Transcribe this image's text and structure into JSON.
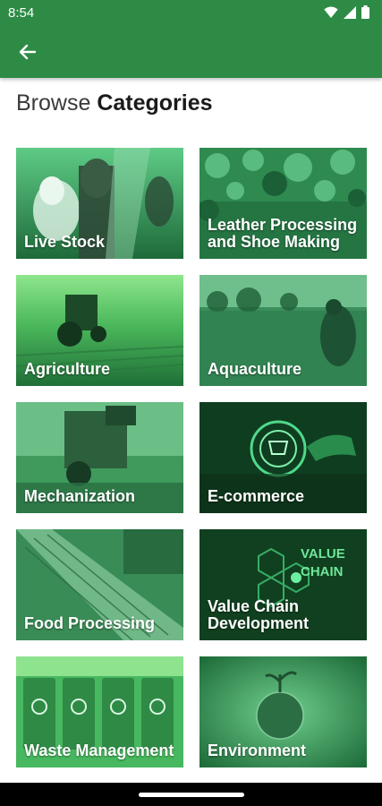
{
  "status_bar": {
    "time": "8:54"
  },
  "app_bar": {
    "back_icon": "arrow-left-icon"
  },
  "heading": {
    "light": "Browse",
    "bold": "Categories"
  },
  "categories": [
    {
      "label": "Live Stock"
    },
    {
      "label": "Leather Processing and Shoe Making"
    },
    {
      "label": "Agriculture"
    },
    {
      "label": "Aquaculture"
    },
    {
      "label": "Mechanization"
    },
    {
      "label": "E-commerce"
    },
    {
      "label": "Food Processing"
    },
    {
      "label": "Value Chain Development"
    },
    {
      "label": "Waste Management"
    },
    {
      "label": "Environment"
    }
  ],
  "tile_overlay_text": {
    "value_chain_badge": "VALUE\nCHAIN"
  },
  "colors": {
    "app_bar": "#2e8b45",
    "tile_tint": "#1f6b3a"
  }
}
